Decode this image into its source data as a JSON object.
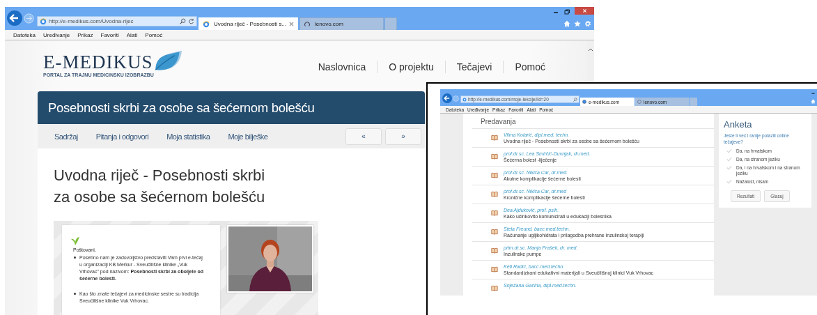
{
  "main_window": {
    "address": "http://e-medikus.com/Uvodna-rijec",
    "tabs": [
      {
        "title": "Uvodna riječ - Posebnosti s...",
        "selected": true
      },
      {
        "title": "lenovo.com",
        "selected": false
      }
    ],
    "menu": [
      "Datoteka",
      "Uređivanje",
      "Prikaz",
      "Favoriti",
      "Alati",
      "Pomoć"
    ],
    "site": {
      "logo": "E-MEDIKUS",
      "tagline": "PORTAL ZA TRAJNU MEDICINSKU IZOBRAZBU",
      "nav": [
        "Naslovnica",
        "O projektu",
        "Tečajevi",
        "Pomoć"
      ],
      "course_title": "Posebnosti skrbi za osobe sa šećernom bolešću",
      "subnav": [
        "Sadržaj",
        "Pitanja i odgovori",
        "Moja statistika",
        "Moje bilješke"
      ],
      "pager": [
        "«",
        "»"
      ],
      "heading": "Uvodna riječ - Posebnosti skrbi za osobe sa šećernom bolešću",
      "slide": {
        "greeting": "Poštovani,",
        "bullets": [
          "Posebno nam je zadovoljstvo predstaviti Vam  prvi e-tečaj u organizaciji KB Merkur - Sveučilišne klinike „Vuk Vrhovac\" pod nazivom: **Posebnosti skrbi za oboljele od šećerne bolesti.**",
          "Kao što znate tečajevi za medicinske sestre su tradicija Sveučilišne klinike Vuk Vrhovac."
        ]
      }
    }
  },
  "inset_window": {
    "address": "http://e-medikus.com/moje-lekcije/lid=20",
    "tabs": [
      {
        "title": "e-medikus.com",
        "selected": true
      },
      {
        "title": "lenovo.com",
        "selected": false
      }
    ],
    "menu": [
      "Datoteka",
      "Uređivanje",
      "Prikaz",
      "Favoriti",
      "Alati",
      "Pomoć"
    ],
    "section_title": "Predavanja",
    "lectures": [
      {
        "author": "Vilma Kolarić, dipl.med. techn.",
        "title": "Uvodna riječ - Posebnosti skrbi za osobe sa šećernom bolešću"
      },
      {
        "author": "prof.dr.sc. Lea Smirčić-Duvnjak, dr.med.",
        "title": "Šećerna bolest -liječenje"
      },
      {
        "author": "prof.dr.sc. Nikica Car, dr.med.",
        "title": "Akutne komplikacije šećerne bolesti"
      },
      {
        "author": "prof.dr.sc. Nikica Car, dr.med",
        "title": "Kronične komplikacije šećerne bolesti"
      },
      {
        "author": "Dea Ajduković, prof. psih.",
        "title": "Kako učinkovito komunicirati u edukaciji bolesnika"
      },
      {
        "author": "Stela Freund, bacc.med.techn.",
        "title": "Računanje ugljikohidrata i prilagodba prehrane inzulinskoj terapiji"
      },
      {
        "author": "prim.dr.sc. Manja Prašek, dr. med.",
        "title": "Inzulinske pumpe"
      },
      {
        "author": "Keti Radić, bacc.med.techn.",
        "title": "Standardizirani edukativni materijali u Sveučilišnoj klinici Vuk Vrhovac"
      },
      {
        "author": "Snježana Gaćina, dipl.med.techn."
      }
    ],
    "poll": {
      "title": "Anketa",
      "question": "Jeste li već i ranije polazili online tečajeve?",
      "options": [
        {
          "label": "Da, na hrvatskom",
          "selected": false
        },
        {
          "label": "Da, na stranom jeziku",
          "selected": false
        },
        {
          "label": "Da, i na hrvatskom i na stranom jeziku",
          "selected": false
        },
        {
          "label": "Nažalost, nisam",
          "selected": false
        }
      ],
      "buttons": [
        "Rezultati",
        "Glasuj"
      ]
    }
  }
}
